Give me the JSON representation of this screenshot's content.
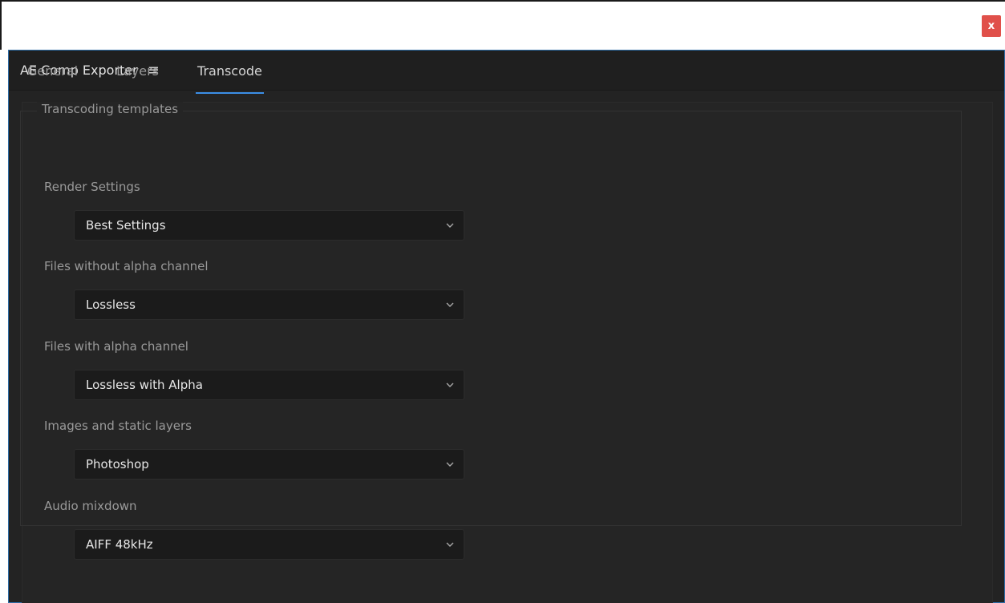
{
  "window": {
    "close_label": "x"
  },
  "panel": {
    "title": "AE Comp Exporter",
    "menu_icon": "hamburger-menu-icon"
  },
  "tabs": [
    {
      "label": "General",
      "active": false
    },
    {
      "label": "Layers",
      "active": false
    },
    {
      "label": "Transcode",
      "active": true
    }
  ],
  "group": {
    "legend": "Transcoding templates",
    "fields": [
      {
        "label": "Render Settings",
        "value": "Best Settings"
      },
      {
        "label": "Files without alpha channel",
        "value": "Lossless"
      },
      {
        "label": "Files with alpha channel",
        "value": "Lossless with Alpha"
      },
      {
        "label": "Images and static layers",
        "value": "Photoshop"
      },
      {
        "label": "Audio mixdown",
        "value": "AIFF 48kHz"
      }
    ]
  },
  "colors": {
    "accent": "#3c8ee6",
    "close_button": "#e0504a",
    "panel_bg": "#232323"
  }
}
